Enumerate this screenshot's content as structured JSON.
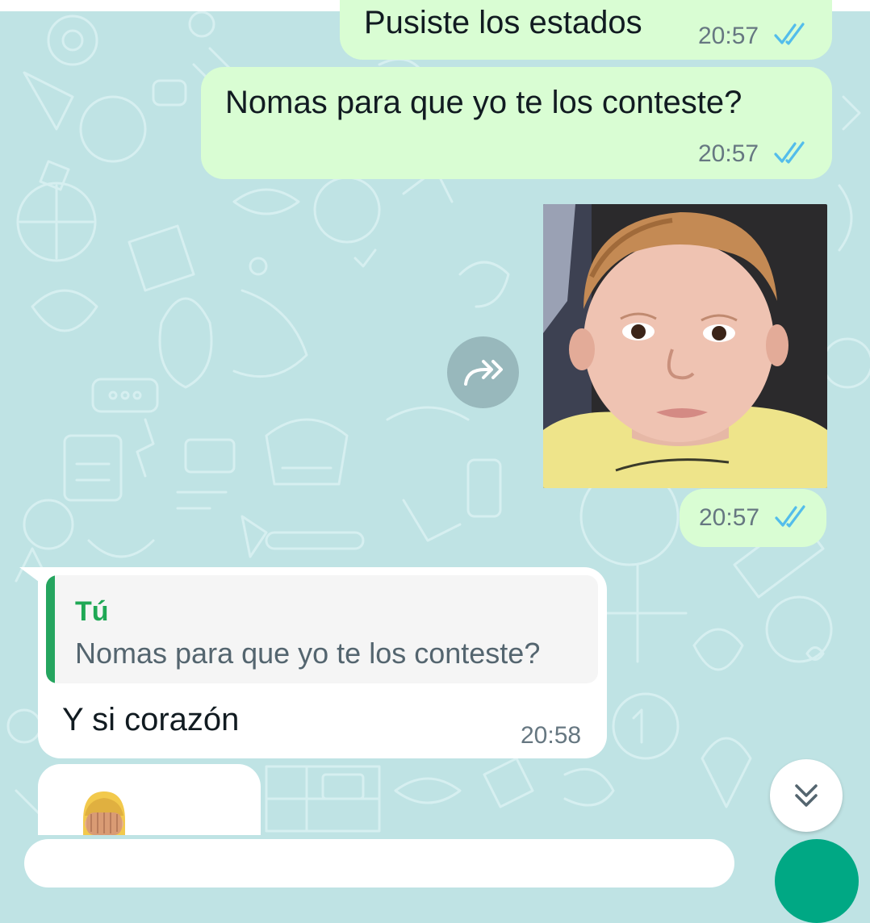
{
  "colors": {
    "wallpaper": "#bfe3e4",
    "outgoing_bubble": "#d9fdd3",
    "incoming_bubble": "#ffffff",
    "read_ticks": "#53bdeb",
    "quote_accent": "#25a55f",
    "send_button": "#00a884"
  },
  "messages": [
    {
      "direction": "outgoing",
      "text": "Pusiste los estados",
      "time": "20:57",
      "status": "read"
    },
    {
      "direction": "outgoing",
      "text": "Nomas para que yo te los conteste?",
      "time": "20:57",
      "status": "read"
    },
    {
      "direction": "outgoing",
      "type": "sticker",
      "image": "toddler-face-sticker",
      "time": "20:57",
      "status": "read"
    },
    {
      "direction": "incoming",
      "quote": {
        "author": "Tú",
        "text": "Nomas para que yo te los conteste?"
      },
      "text": "Y si corazón",
      "time": "20:58"
    },
    {
      "direction": "incoming",
      "type": "emoji",
      "emoji": "🤦🏼"
    }
  ],
  "icons": {
    "forward": "forward-icon",
    "scroll_down": "double-chevron-down-icon",
    "read_receipt": "double-check-icon"
  }
}
